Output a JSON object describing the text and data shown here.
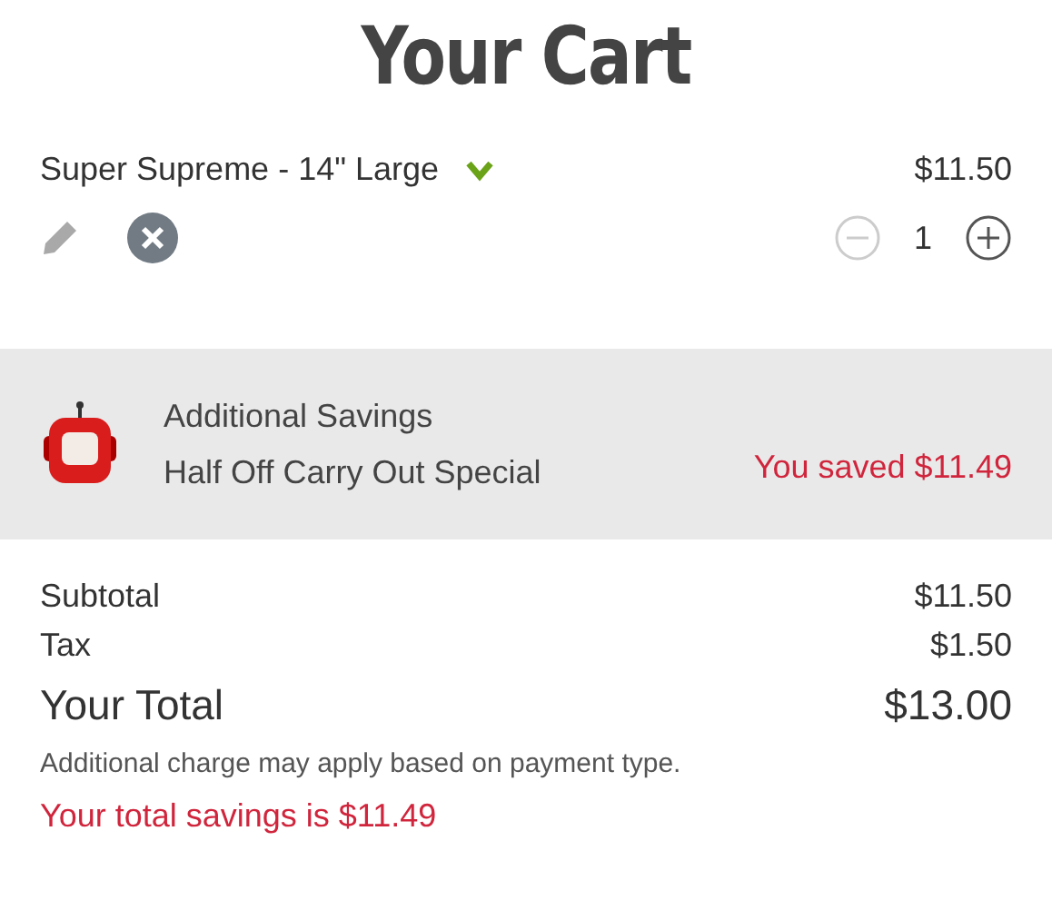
{
  "title": "Your Cart",
  "items": [
    {
      "name": "Super Supreme - 14\" Large",
      "price": "$11.50",
      "quantity": "1",
      "decrement_disabled": true,
      "increment_disabled": false
    }
  ],
  "savings": {
    "heading": "Additional Savings",
    "deal": "Half Off Carry Out Special",
    "saved": "You saved $11.49"
  },
  "summary": [
    {
      "kind": "line",
      "label": "Subtotal",
      "value": "$11.50"
    },
    {
      "kind": "line",
      "label": "Tax",
      "value": "$1.50"
    },
    {
      "kind": "total",
      "label": "Your Total",
      "value": "$13.00"
    }
  ],
  "note": "Additional charge may apply based on payment type.",
  "total_savings": "Your total savings is $11.49"
}
